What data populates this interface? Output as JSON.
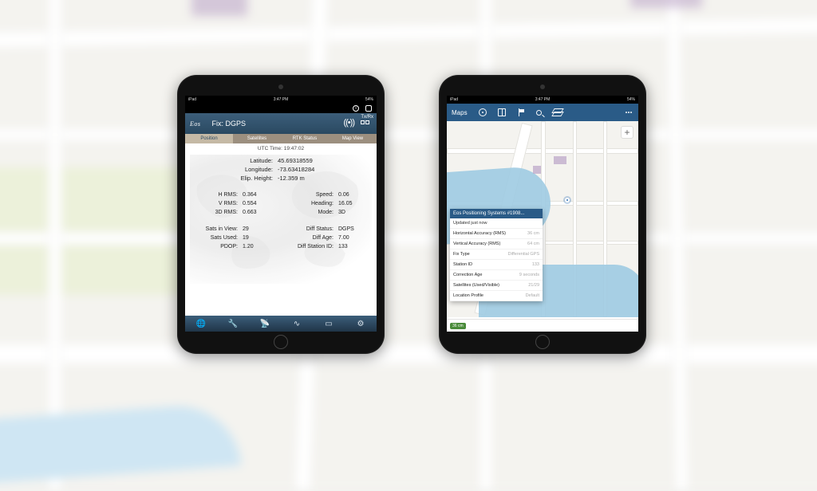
{
  "status_bar": {
    "time": "3:47 PM",
    "carrier": "iPad",
    "battery": "54%"
  },
  "eos_app": {
    "brand": "Eos",
    "fix_label": "Fix: DGPS",
    "txrx": "Tx/Rx",
    "tabs": {
      "position": "Position",
      "satellites": "Satellites",
      "rtk": "RTK Status",
      "map": "Map View"
    },
    "utc": "UTC Time: 19:47:02",
    "coords": {
      "lat_k": "Latitude:",
      "lat_v": "45.69318559",
      "lon_k": "Longitude:",
      "lon_v": "-73.63418284",
      "hgt_k": "Elip. Height:",
      "hgt_v": "-12.359 m"
    },
    "rms": {
      "h_k": "H RMS:",
      "h_v": "0.364",
      "v_k": "V RMS:",
      "v_v": "0.554",
      "d3_k": "3D RMS:",
      "d3_v": "0.663"
    },
    "motion": {
      "spd_k": "Speed:",
      "spd_v": "0.06",
      "hdg_k": "Heading:",
      "hdg_v": "16.05",
      "mode_k": "Mode:",
      "mode_v": "3D"
    },
    "sats": {
      "view_k": "Sats in View:",
      "view_v": "29",
      "used_k": "Sats Used:",
      "used_v": "19",
      "pdop_k": "PDOP:",
      "pdop_v": "1.20"
    },
    "diff": {
      "stat_k": "Diff Status:",
      "stat_v": "DGPS",
      "age_k": "Diff Age:",
      "age_v": "7.00",
      "stn_k": "Diff Station ID:",
      "stn_v": "133"
    }
  },
  "collector": {
    "back": "Maps",
    "zoom_in": "+",
    "panel_title": "Eos Positioning Systems #1908...",
    "updated": "Updated just now",
    "rows": {
      "ha_k": "Horizontal Accuracy (RMS)",
      "ha_v": "36 cm",
      "va_k": "Vertical Accuracy (RMS)",
      "va_v": "64 cm",
      "ft_k": "Fix Type",
      "ft_v": "Differential GPS",
      "sid_k": "Station ID",
      "sid_v": "133",
      "ca_k": "Correction Age",
      "ca_v": "9 seconds",
      "sat_k": "Satellites (Used/Visible)",
      "sat_v": "21/29",
      "lp_k": "Location Profile",
      "lp_v": "Default"
    },
    "badge": "36 cm"
  }
}
